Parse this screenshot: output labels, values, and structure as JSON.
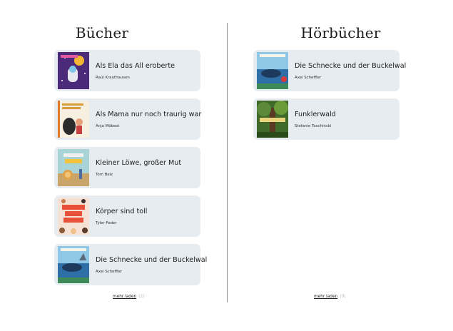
{
  "books": {
    "heading": "Bücher",
    "more_label": "mehr laden",
    "more_count": "(2)",
    "items": [
      {
        "title": "Als Ela das All eroberte",
        "author": "Raúl Krauthausen",
        "cover_icon": "space-cover-image"
      },
      {
        "title": "Als Mama nur noch traurig war",
        "author": "Anja Möbest",
        "cover_icon": "mama-cover-image"
      },
      {
        "title": "Kleiner Löwe, großer Mut",
        "author": "Tom Belz",
        "cover_icon": "lion-cover-image"
      },
      {
        "title": "Körper sind toll",
        "author": "Tyler Feder",
        "cover_icon": "body-cover-image"
      },
      {
        "title": "Die Schnecke und der Buckelwal",
        "author": "Axel Scheffler",
        "cover_icon": "whale-cover-image"
      }
    ]
  },
  "audiobooks": {
    "heading": "Hörbücher",
    "more_label": "mehr laden",
    "more_count": "(0)",
    "items": [
      {
        "title": "Die Schnecke und der Buckelwal",
        "author": "Axel Scheffler",
        "cover_icon": "whale-cover-image"
      },
      {
        "title": "Funklerwald",
        "author": "Stefanie Toschinski",
        "cover_icon": "forest-cover-image"
      }
    ]
  },
  "colors": {
    "card_bg": "#e6ecef",
    "divider": "#8a8a8a"
  }
}
